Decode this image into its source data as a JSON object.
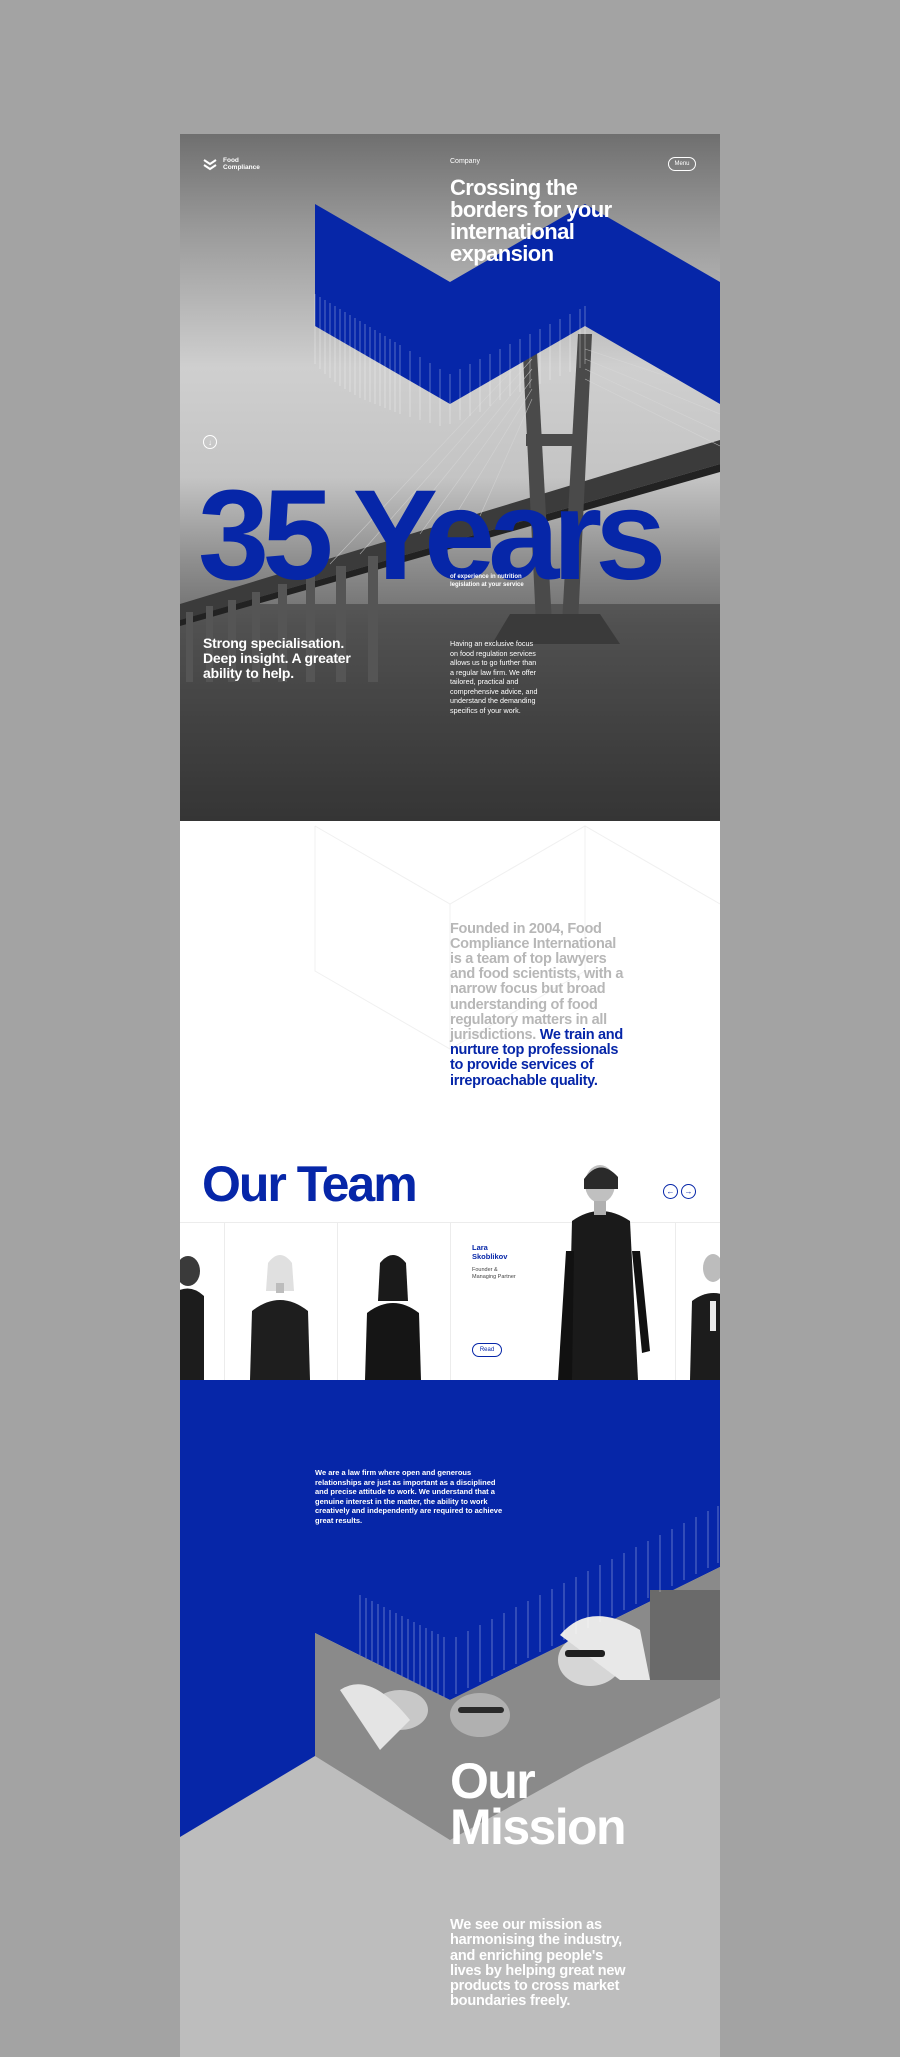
{
  "colors": {
    "brand_blue": "#0626a8",
    "page_background": "#a3a3a3"
  },
  "header": {
    "logo_text": "Food\nCompliance",
    "nav_label": "Company",
    "menu_label": "Menu"
  },
  "hero": {
    "headline": "Crossing the borders for your international expansion",
    "big_number": "35 Years",
    "big_number_caption": "of experience in nutrition legislation at your service",
    "tagline": "Strong specialisation. Deep insight. A greater ability to help.",
    "body": "Having an exclusive focus on food regulation services allows us to go further than a regular law firm. We offer tailored, practical and comprehensive advice, and understand the demanding specifics of your work.",
    "scroll_icon": "arrow-down-icon"
  },
  "about": {
    "text_grey": "Founded in 2004, Food Compliance International is a team of top lawyers and food scientists, with a narrow focus but broad understanding of food regulatory matters in all jurisdictions.",
    "text_blue": "We train and nurture top professionals to provide services of irreproachable quality."
  },
  "team": {
    "title": "Our Team",
    "prev_icon": "arrow-left-icon",
    "next_icon": "arrow-right-icon",
    "featured_member": {
      "name": "Lara\nSkoblikov",
      "role": "Founder &\nManaging Partner",
      "read_label": "Read"
    }
  },
  "values": {
    "text": "We are a law firm where open and generous relationships are just as important as a disciplined and precise attitude to work. We understand that a genuine interest in the matter, the ability to work creatively and independently are required to achieve great results."
  },
  "mission": {
    "title": "Our\nMission",
    "text": "We see our mission as harmonising the industry, and enriching people's lives by helping great new products to cross market boundaries freely."
  }
}
